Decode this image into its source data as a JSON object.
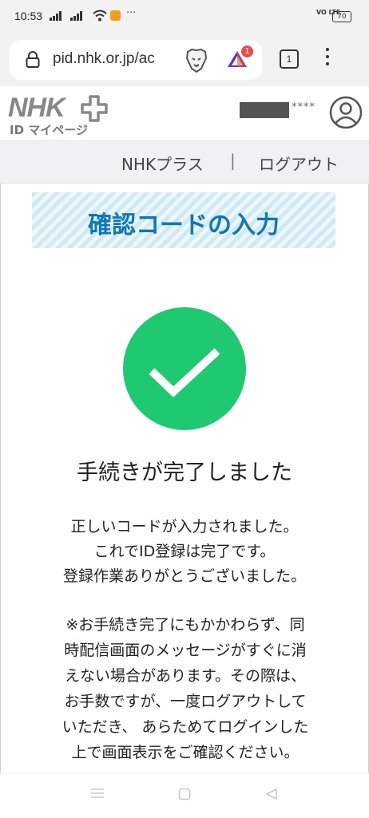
{
  "status_bar": {
    "time": "10:53",
    "network_label": "VO LTE",
    "battery_level": "70",
    "more": "···"
  },
  "browser": {
    "url": "pid.nhk.or.jp/ac",
    "notification_count": "1",
    "tab_count": "1"
  },
  "site_header": {
    "logo_text": "NHK",
    "logo_sub": "ID マイページ",
    "user_masked_suffix": "****"
  },
  "nav": {
    "nhk_plus": "NHKプラス",
    "separator": "|",
    "logout": "ログアウト"
  },
  "main": {
    "heading": "確認コードの入力",
    "done_title": "手続きが完了しました",
    "message_lines": [
      "正しいコードが入力されました。",
      "これでID登録は完了です。",
      "登録作業ありがとうございました。"
    ],
    "note_lines": [
      "※お手続き完了にもかかわらず、同",
      "時配信画面のメッセージがすぐに消",
      "えない場合があります。その際は、",
      "お手数ですが、一度ログアウトして",
      "いただき、 あらためてログインした",
      "上で画面表示をご確認ください。"
    ]
  },
  "colors": {
    "success_green": "#1ec971",
    "heading_blue": "#0f77b8"
  }
}
